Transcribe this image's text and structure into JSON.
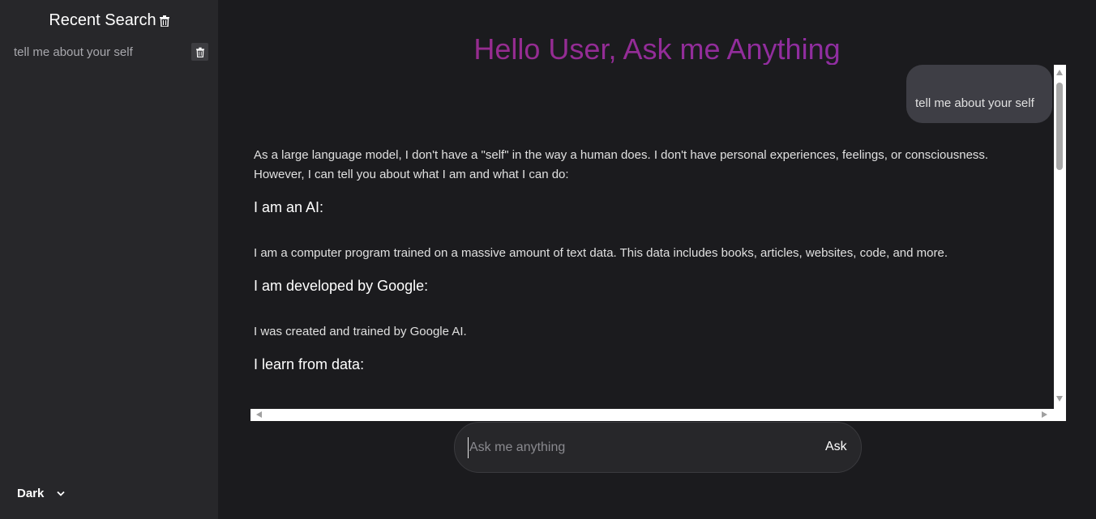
{
  "sidebar": {
    "title": "Recent Search",
    "history": [
      {
        "label": "tell me about your self"
      }
    ],
    "theme_label": "Dark"
  },
  "main": {
    "title": "Hello User, Ask me Anything",
    "user_message": "tell me about your self",
    "answer": {
      "intro": "As a large language model, I don't have a \"self\" in the way a human does. I don't have personal experiences, feelings, or consciousness. However, I can tell you about what I am and what I can do:",
      "sections": [
        {
          "heading": "I am an AI:",
          "text": "I am a computer program trained on a massive amount of text data. This data includes books, articles, websites, code, and more."
        },
        {
          "heading": "I am developed by Google:",
          "text": "I was created and trained by Google AI."
        },
        {
          "heading": "I learn from data:",
          "text": ""
        }
      ]
    },
    "input": {
      "placeholder": "Ask me anything",
      "value": ""
    },
    "ask_label": "Ask"
  },
  "colors": {
    "background": "#1b1b1e",
    "sidebar": "#27272a",
    "title_gradient_start": "#9b2a82",
    "title_gradient_end": "#8b2fae",
    "user_bubble": "#3e3e45"
  },
  "icons": {
    "header_trash": "trash-icon",
    "item_trash": "trash-icon",
    "theme_chevron": "chevron-down-icon"
  }
}
